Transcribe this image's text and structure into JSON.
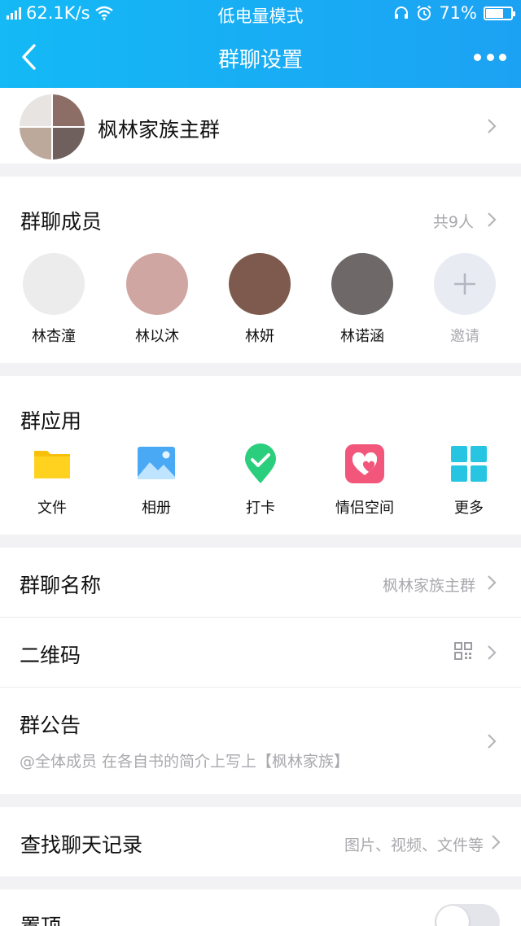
{
  "status": {
    "speed": "62.1K/s",
    "mode": "低电量模式",
    "battery": "71%",
    "battery_level": 0.71
  },
  "nav": {
    "title": "群聊设置"
  },
  "group": {
    "name": "枫林家族主群"
  },
  "members": {
    "title": "群聊成员",
    "count": "共9人",
    "list": [
      {
        "name": "林杏潼",
        "avatar_color": "#ececec"
      },
      {
        "name": "林以沐",
        "avatar_color": "#cfa6a2"
      },
      {
        "name": "林妍",
        "avatar_color": "#7d5a4d"
      },
      {
        "name": "林诺涵",
        "avatar_color": "#6e6868"
      }
    ],
    "invite_label": "邀请"
  },
  "apps": {
    "title": "群应用",
    "items": [
      {
        "label": "文件",
        "icon": "folder-icon"
      },
      {
        "label": "相册",
        "icon": "photo-album-icon"
      },
      {
        "label": "打卡",
        "icon": "check-in-icon"
      },
      {
        "label": "情侣空间",
        "icon": "couple-space-icon"
      },
      {
        "label": "更多",
        "icon": "more-apps-icon"
      }
    ]
  },
  "settings": {
    "name_label": "群聊名称",
    "name_value": "枫林家族主群",
    "qr_label": "二维码",
    "notice_label": "群公告",
    "notice_text": "@全体成员 在各自书的简介上写上【枫林家族】"
  },
  "search": {
    "label": "查找聊天记录",
    "hint": "图片、视频、文件等"
  },
  "pin": {
    "label": "置顶",
    "enabled": false
  },
  "colors": {
    "header_start": "#14b9f5",
    "header_end": "#1ca2f3",
    "page_bg": "#f2f2f5",
    "secondary_text": "#a9a9ae"
  }
}
